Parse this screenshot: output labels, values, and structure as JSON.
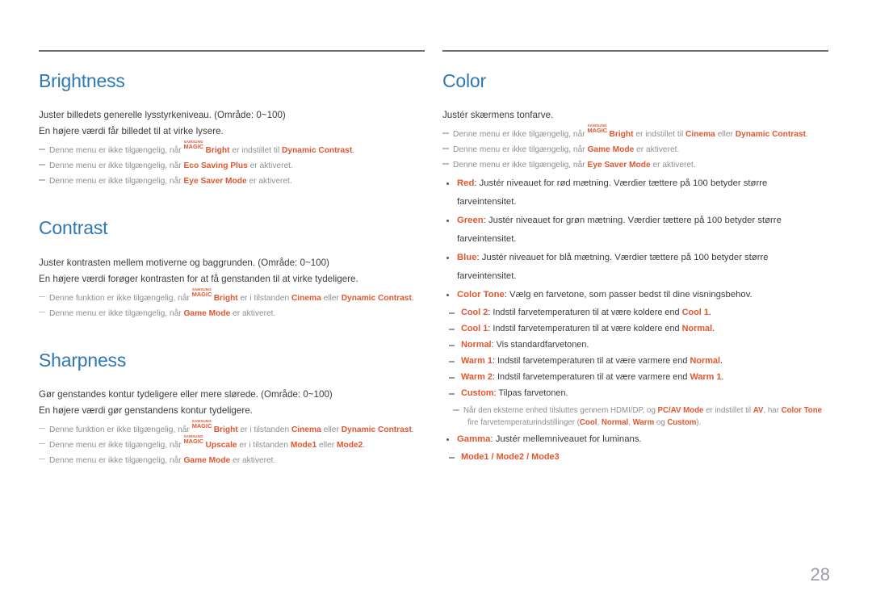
{
  "page": {
    "number": "28",
    "accent_blue": "#2f77b5",
    "accent_orange": "#e2562f",
    "body_gray": "#3c3c3c",
    "note_gray": "#8f8f8f"
  },
  "magic_logo": {
    "top": "SAMSUNG",
    "bottom": "MAGIC"
  },
  "left_column": {
    "brightness": {
      "title": "Brightness",
      "body": [
        "Juster billedets generelle lysstyrkeniveau. (Område: 0~100)",
        "En højere værdi får billedet til at virke lysere."
      ],
      "notes": [
        {
          "parts": [
            {
              "t": "Denne menu er ikke tilgængelig, når ",
              "hl": false
            },
            {
              "t": "MAGIC_LOGO",
              "hl": false
            },
            {
              "t": "Bright",
              "hl": true
            },
            {
              "t": " er indstillet til ",
              "hl": false
            },
            {
              "t": "Dynamic Contrast",
              "hl": true
            },
            {
              "t": ".",
              "hl": false
            }
          ]
        },
        {
          "parts": [
            {
              "t": "Denne menu er ikke tilgængelig, når ",
              "hl": false
            },
            {
              "t": "Eco Saving Plus",
              "hl": true
            },
            {
              "t": " er aktiveret.",
              "hl": false
            }
          ]
        },
        {
          "parts": [
            {
              "t": "Denne menu er ikke tilgængelig, når ",
              "hl": false
            },
            {
              "t": "Eye Saver Mode",
              "hl": true
            },
            {
              "t": " er aktiveret.",
              "hl": false
            }
          ]
        }
      ]
    },
    "contrast": {
      "title": "Contrast",
      "body": [
        "Juster kontrasten mellem motiverne og baggrunden. (Område: 0~100)",
        "En højere værdi forøger kontrasten for at få genstanden til at virke tydeligere."
      ],
      "notes": [
        {
          "parts": [
            {
              "t": "Denne funktion er ikke tilgængelig, når ",
              "hl": false
            },
            {
              "t": "MAGIC_LOGO",
              "hl": false
            },
            {
              "t": "Bright",
              "hl": true
            },
            {
              "t": " er i tilstanden ",
              "hl": false
            },
            {
              "t": "Cinema",
              "hl": true
            },
            {
              "t": " eller ",
              "hl": false
            },
            {
              "t": "Dynamic Contrast",
              "hl": true
            },
            {
              "t": ".",
              "hl": false
            }
          ]
        },
        {
          "parts": [
            {
              "t": "Denne menu er ikke tilgængelig, når ",
              "hl": false
            },
            {
              "t": "Game Mode",
              "hl": true
            },
            {
              "t": " er aktiveret.",
              "hl": false
            }
          ]
        }
      ]
    },
    "sharpness": {
      "title": "Sharpness",
      "body": [
        "Gør genstandes kontur tydeligere eller mere slørede. (Område: 0~100)",
        "En højere værdi gør genstandens kontur tydeligere."
      ],
      "notes": [
        {
          "parts": [
            {
              "t": "Denne funktion er ikke tilgængelig, når ",
              "hl": false
            },
            {
              "t": "MAGIC_LOGO",
              "hl": false
            },
            {
              "t": "Bright",
              "hl": true
            },
            {
              "t": " er i tilstanden ",
              "hl": false
            },
            {
              "t": "Cinema",
              "hl": true
            },
            {
              "t": " eller ",
              "hl": false
            },
            {
              "t": "Dynamic Contrast",
              "hl": true
            },
            {
              "t": ".",
              "hl": false
            }
          ]
        },
        {
          "parts": [
            {
              "t": "Denne menu er ikke tilgængelig, når ",
              "hl": false
            },
            {
              "t": "MAGIC_LOGO",
              "hl": false
            },
            {
              "t": "Upscale",
              "hl": true
            },
            {
              "t": " er i tilstanden ",
              "hl": false
            },
            {
              "t": "Mode1",
              "hl": true
            },
            {
              "t": " eller ",
              "hl": false
            },
            {
              "t": "Mode2",
              "hl": true
            },
            {
              "t": ".",
              "hl": false
            }
          ]
        },
        {
          "parts": [
            {
              "t": "Denne menu er ikke tilgængelig, når ",
              "hl": false
            },
            {
              "t": "Game Mode",
              "hl": true
            },
            {
              "t": " er aktiveret.",
              "hl": false
            }
          ]
        }
      ]
    }
  },
  "right_column": {
    "color": {
      "title": "Color",
      "body": [
        "Justér skærmens tonfarve."
      ],
      "notes": [
        {
          "parts": [
            {
              "t": "Denne menu er ikke tilgængelig, når ",
              "hl": false
            },
            {
              "t": "MAGIC_LOGO",
              "hl": false
            },
            {
              "t": "Bright",
              "hl": true
            },
            {
              "t": " er indstillet til ",
              "hl": false
            },
            {
              "t": "Cinema",
              "hl": true
            },
            {
              "t": " eller ",
              "hl": false
            },
            {
              "t": "Dynamic Contrast",
              "hl": true
            },
            {
              "t": ".",
              "hl": false
            }
          ]
        },
        {
          "parts": [
            {
              "t": "Denne menu er ikke tilgængelig, når ",
              "hl": false
            },
            {
              "t": "Game Mode",
              "hl": true
            },
            {
              "t": " er aktiveret.",
              "hl": false
            }
          ]
        },
        {
          "parts": [
            {
              "t": "Denne menu er ikke tilgængelig, når ",
              "hl": false
            },
            {
              "t": "Eye Saver Mode",
              "hl": true
            },
            {
              "t": " er aktiveret.",
              "hl": false
            }
          ]
        }
      ],
      "bullets": [
        {
          "parts": [
            {
              "t": "Red",
              "hl": true
            },
            {
              "t": ": Justér niveauet for rød mætning. Værdier tættere på 100 betyder større farveintensitet.",
              "hl": false
            }
          ]
        },
        {
          "parts": [
            {
              "t": "Green",
              "hl": true
            },
            {
              "t": ": Justér niveauet for grøn mætning. Værdier tættere på 100 betyder større farveintensitet.",
              "hl": false
            }
          ]
        },
        {
          "parts": [
            {
              "t": "Blue",
              "hl": true
            },
            {
              "t": ": Justér niveauet for blå mætning. Værdier tættere på 100 betyder større farveintensitet.",
              "hl": false
            }
          ]
        },
        {
          "parts": [
            {
              "t": "Color Tone",
              "hl": true
            },
            {
              "t": ": Vælg en farvetone, som passer bedst til dine visningsbehov.",
              "hl": false
            }
          ]
        }
      ],
      "color_tone_options": [
        {
          "parts": [
            {
              "t": "Cool 2",
              "hl": true
            },
            {
              "t": ": Indstil farvetemperaturen til at være koldere end ",
              "hl": false
            },
            {
              "t": "Cool 1",
              "hl": true
            },
            {
              "t": ".",
              "hl": false
            }
          ]
        },
        {
          "parts": [
            {
              "t": "Cool 1",
              "hl": true
            },
            {
              "t": ": Indstil farvetemperaturen til at være koldere end ",
              "hl": false
            },
            {
              "t": "Normal",
              "hl": true
            },
            {
              "t": ".",
              "hl": false
            }
          ]
        },
        {
          "parts": [
            {
              "t": "Normal",
              "hl": true
            },
            {
              "t": ": Vis standardfarvetonen.",
              "hl": false
            }
          ]
        },
        {
          "parts": [
            {
              "t": "Warm 1",
              "hl": true
            },
            {
              "t": ": Indstil farvetemperaturen til at være varmere end ",
              "hl": false
            },
            {
              "t": "Normal",
              "hl": true
            },
            {
              "t": ".",
              "hl": false
            }
          ]
        },
        {
          "parts": [
            {
              "t": "Warm 2",
              "hl": true
            },
            {
              "t": ": Indstil farvetemperaturen til at være varmere end ",
              "hl": false
            },
            {
              "t": "Warm 1",
              "hl": true
            },
            {
              "t": ".",
              "hl": false
            }
          ]
        },
        {
          "parts": [
            {
              "t": "Custom",
              "hl": true
            },
            {
              "t": ": Tilpas farvetonen.",
              "hl": false
            }
          ]
        }
      ],
      "hdmi_note": {
        "line1": [
          {
            "t": "Når den eksterne enhed tilsluttes gennem HDMI/DP, og ",
            "hl": false
          },
          {
            "t": "PC/AV Mode",
            "hl": true
          },
          {
            "t": " er indstillet til ",
            "hl": false
          },
          {
            "t": "AV",
            "hl": true
          },
          {
            "t": ", har ",
            "hl": false
          },
          {
            "t": "Color Tone",
            "hl": true
          }
        ],
        "line2": [
          {
            "t": "fire farvetemperaturindstillinger (",
            "hl": false
          },
          {
            "t": "Cool",
            "hl": true
          },
          {
            "t": ", ",
            "hl": false
          },
          {
            "t": "Normal",
            "hl": true
          },
          {
            "t": ", ",
            "hl": false
          },
          {
            "t": "Warm",
            "hl": true
          },
          {
            "t": " og ",
            "hl": false
          },
          {
            "t": "Custom",
            "hl": true
          },
          {
            "t": ").",
            "hl": false
          }
        ]
      },
      "gamma_bullet": {
        "parts": [
          {
            "t": "Gamma",
            "hl": true
          },
          {
            "t": ": Justér mellemniveauet for luminans.",
            "hl": false
          }
        ]
      },
      "gamma_options": [
        {
          "parts": [
            {
              "t": "Mode1 / Mode2 / Mode3",
              "hl": true
            }
          ]
        }
      ]
    }
  }
}
